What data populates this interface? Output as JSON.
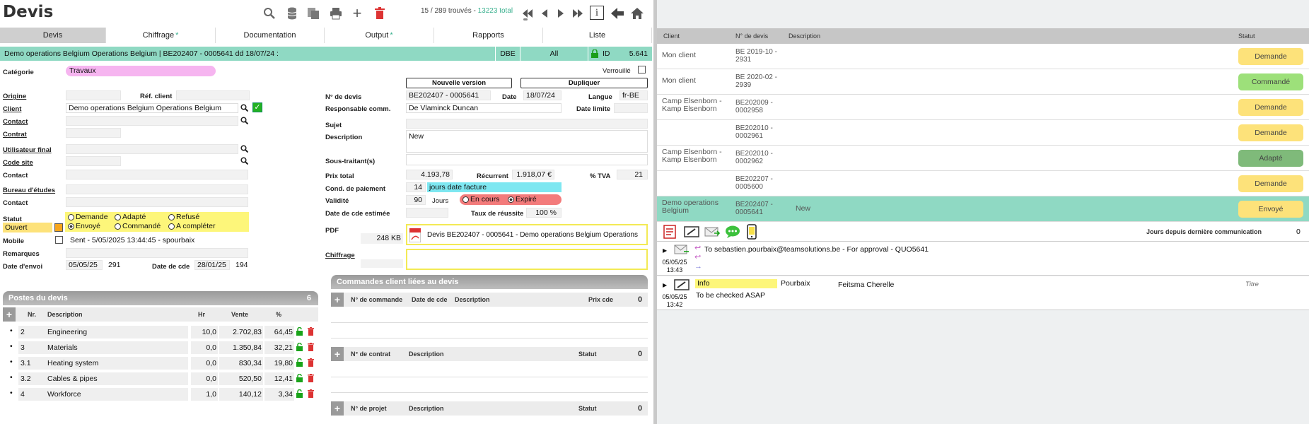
{
  "header": {
    "title": "Devis",
    "count_text": "15 / 289 trouvés -",
    "count_total": "13223 total"
  },
  "tabs": [
    {
      "label": "Devis",
      "star": ""
    },
    {
      "label": "Chiffrage",
      "star": "*"
    },
    {
      "label": "Documentation",
      "star": ""
    },
    {
      "label": "Output",
      "star": "*"
    },
    {
      "label": "Rapports",
      "star": ""
    },
    {
      "label": "Liste",
      "star": ""
    }
  ],
  "banner": {
    "text": "Demo operations Belgium Operations Belgium | BE202407 - 0005641 dd 18/07/24 :",
    "dbe": "DBE",
    "all": "All",
    "id_label": "ID",
    "id_value": "5.641"
  },
  "form": {
    "categorie_label": "Catégorie",
    "categorie": "Travaux",
    "verrouille": "Verrouillé",
    "origine": "Origine",
    "ref_client": "Réf. client",
    "client": "Client",
    "client_value": "Demo operations Belgium Operations Belgium",
    "contact": "Contact",
    "contrat": "Contrat",
    "utilisateur_final": "Utilisateur final",
    "code_site": "Code site",
    "contact2": "Contact",
    "bureau": "Bureau d'études",
    "contact3": "Contact",
    "statut": "Statut",
    "ouvert": "Ouvert",
    "radios": [
      "Demande",
      "Adapté",
      "Refusé",
      "Envoyé",
      "Commandé",
      "A compléter"
    ],
    "mobile": "Mobile",
    "mobile_value": "Sent - 5/05/2025 13:44:45 - spourbaix",
    "remarques": "Remarques",
    "date_envoi_label": "Date d'envoi",
    "date_envoi": "05/05/25",
    "date_envoi_n": "291",
    "date_cde_label": "Date de cde",
    "date_cde": "28/01/25",
    "date_cde_n": "194",
    "nouvelle_version": "Nouvelle version",
    "dupliquer": "Dupliquer",
    "no_devis_label": "N° de devis",
    "no_devis": "BE202407 - 0005641",
    "date_label": "Date",
    "date": "18/07/24",
    "langue_label": "Langue",
    "langue": "fr-BE",
    "resp_label": "Responsable comm.",
    "resp": "De Vlaminck Duncan",
    "date_limite": "Date limite",
    "sujet": "Sujet",
    "description_label": "Description",
    "description": "New",
    "sous_traitants": "Sous-traitant(s)",
    "prix_total_label": "Prix total",
    "prix_total": "4.193,78",
    "recurrent_label": "Récurrent",
    "recurrent": "1.918,07 €",
    "tva_label": "% TVA",
    "tva": "21",
    "cond_label": "Cond. de paiement",
    "cond_n": "14",
    "cond": "jours date facture",
    "validite_label": "Validité",
    "validite_n": "90",
    "jours": "Jours",
    "en_cours": "En cours",
    "expire": "Expiré",
    "date_cde_est": "Date de cde estimée",
    "taux_label": "Taux de réussite",
    "taux": "100 %",
    "pdf_label": "PDF",
    "pdf_size": "248 KB",
    "pdf_name": "Devis BE202407 - 0005641 - Demo operations Belgium Operations",
    "chiffrage": "Chiffrage"
  },
  "postes": {
    "title": "Postes du devis",
    "count": "6",
    "cols": [
      "Nr.",
      "Description",
      "Hr",
      "Vente",
      "%"
    ],
    "rows": [
      {
        "nr": "2",
        "desc": "Engineering",
        "hr": "10,0",
        "vente": "2.702,83",
        "pct": "64,45"
      },
      {
        "nr": "3",
        "desc": "Materials",
        "hr": "0,0",
        "vente": "1.350,84",
        "pct": "32,21"
      },
      {
        "nr": "3.1",
        "desc": "Heating system",
        "hr": "0,0",
        "vente": "830,34",
        "pct": "19,80"
      },
      {
        "nr": "3.2",
        "desc": "Cables & pipes",
        "hr": "0,0",
        "vente": "520,50",
        "pct": "12,41"
      },
      {
        "nr": "4",
        "desc": "Workforce",
        "hr": "1,0",
        "vente": "140,12",
        "pct": "3,34"
      }
    ]
  },
  "commandes": {
    "title": "Commandes client liées au devis",
    "cmd_cols": [
      "N° de commande",
      "Date de cde",
      "Description",
      "Prix cde"
    ],
    "cmd_count": "0",
    "contrat_cols": [
      "N° de contrat",
      "Description",
      "Statut"
    ],
    "contrat_count": "0",
    "projet_cols": [
      "N° de projet",
      "Description",
      "Statut"
    ],
    "projet_count": "0"
  },
  "list": {
    "cols": [
      "Client",
      "N° de devis",
      "Description",
      "Statut"
    ],
    "rows": [
      {
        "client": "Mon client",
        "num": "BE 2019-10 - 2931",
        "desc": "",
        "statut": "Demande",
        "color": "#fde27a"
      },
      {
        "client": "Mon client",
        "num": "BE 2020-02 - 2939",
        "desc": "",
        "statut": "Commandé",
        "color": "#9de07a"
      },
      {
        "client": "Camp Elsenborn - Kamp Elsenborn",
        "num": "BE202009 - 0002958",
        "desc": "",
        "statut": "Demande",
        "color": "#fde27a"
      },
      {
        "client": "",
        "num": "BE202010 - 0002961",
        "desc": "",
        "statut": "Demande",
        "color": "#fde27a"
      },
      {
        "client": "Camp Elsenborn - Kamp Elsenborn",
        "num": "BE202010 - 0002962",
        "desc": "",
        "statut": "Adapté",
        "color": "#7fba7a"
      },
      {
        "client": "",
        "num": "BE202207 - 0005600",
        "desc": "",
        "statut": "Demande",
        "color": "#fde27a"
      },
      {
        "client": "Demo operations Belgium",
        "num": "BE202407 - 0005641",
        "desc": "New",
        "statut": "Envoyé",
        "color": "#fde27a"
      }
    ]
  },
  "comms": {
    "jours_label": "Jours depuis dernière communication",
    "jours": "0",
    "items": [
      {
        "date": "05/05/25",
        "time": "13:43",
        "text": "To sebastien.pourbaix@teamsolutions.be - For approval - QUO5641"
      },
      {
        "date": "05/05/25",
        "time": "13:42",
        "tag": "Info",
        "who": "Pourbaix",
        "person": "Feitsma Cherelle",
        "titre": "Titre",
        "text": "To be checked ASAP"
      }
    ]
  }
}
